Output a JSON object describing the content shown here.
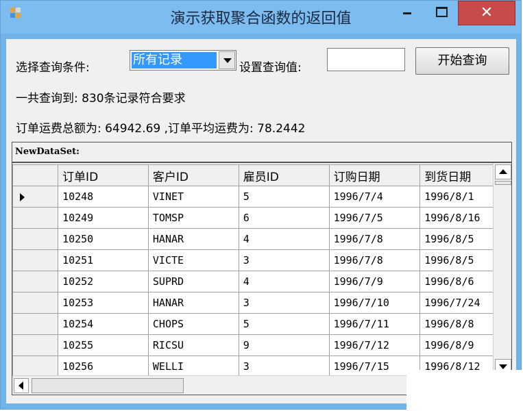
{
  "window": {
    "title": "演示获取聚合函数的返回值",
    "close_glyph": "✕"
  },
  "form": {
    "condition_label": "选择查询条件:",
    "condition_selected": "所有记录",
    "value_label": "设置查询值:",
    "value_input": "",
    "query_button": "开始查询",
    "count_text": "一共查询到: 830条记录符合要求",
    "freight_text": "订单运费总额为: 64942.69  ,订单平均运费为: 78.2442"
  },
  "grid": {
    "caption": "NewDataSet:",
    "columns": [
      "订单ID",
      "客户ID",
      "雇员ID",
      "订购日期",
      "到货日期"
    ],
    "rows": [
      [
        "10248",
        "VINET",
        "5",
        "1996/7/4",
        "1996/8/1"
      ],
      [
        "10249",
        "TOMSP",
        "6",
        "1996/7/5",
        "1996/8/16"
      ],
      [
        "10250",
        "HANAR",
        "4",
        "1996/7/8",
        "1996/8/5"
      ],
      [
        "10251",
        "VICTE",
        "3",
        "1996/7/8",
        "1996/8/5"
      ],
      [
        "10252",
        "SUPRD",
        "4",
        "1996/7/9",
        "1996/8/6"
      ],
      [
        "10253",
        "HANAR",
        "3",
        "1996/7/10",
        "1996/7/24"
      ],
      [
        "10254",
        "CHOPS",
        "5",
        "1996/7/11",
        "1996/8/8"
      ],
      [
        "10255",
        "RICSU",
        "9",
        "1996/7/12",
        "1996/8/9"
      ],
      [
        "10256",
        "WELLI",
        "3",
        "1996/7/15",
        "1996/8/12"
      ]
    ],
    "current_row": 0
  },
  "colors": {
    "titlebar": "#7cbcf0",
    "close": "#c74b4b",
    "selection": "#3399ff"
  }
}
